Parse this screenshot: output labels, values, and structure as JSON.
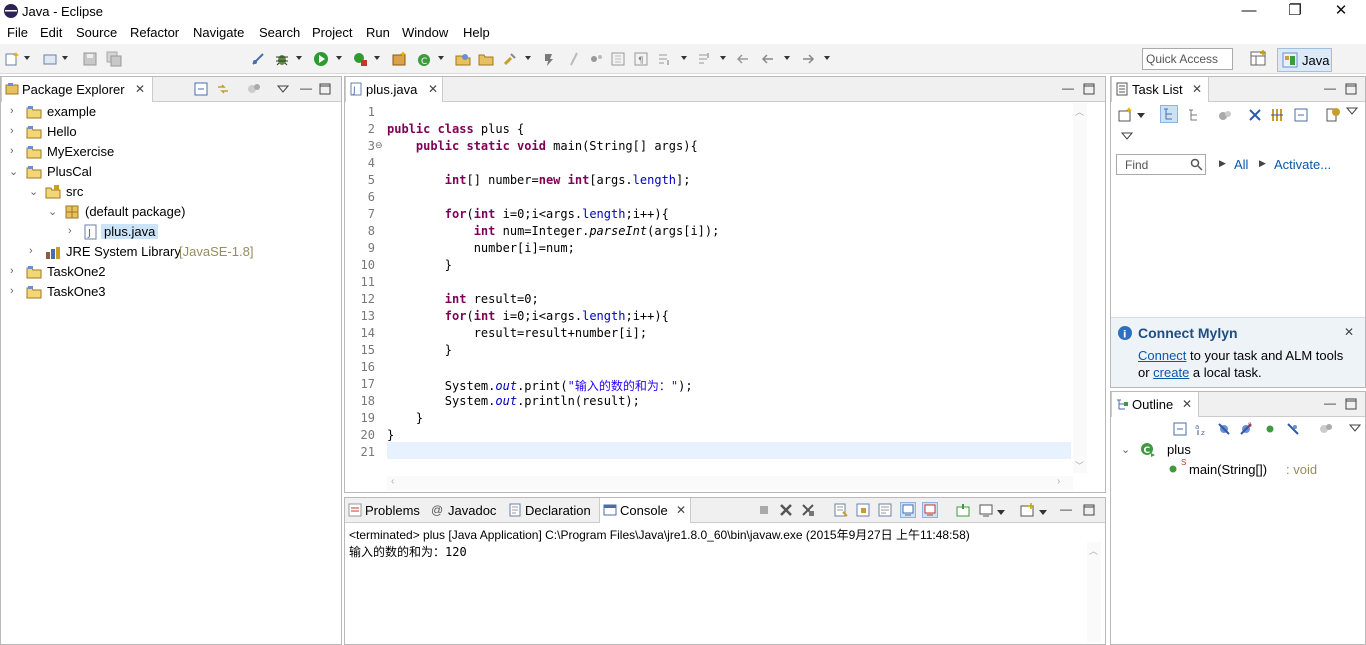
{
  "window": {
    "title": "Java - Eclipse",
    "minimize": "—",
    "maximize": "❐",
    "close": "✕"
  },
  "menu": [
    "File",
    "Edit",
    "Source",
    "Refactor",
    "Navigate",
    "Search",
    "Project",
    "Run",
    "Window",
    "Help"
  ],
  "toolbar": {
    "quick_access_placeholder": "Quick Access",
    "perspective": "Java"
  },
  "package_explorer": {
    "tab": "Package Explorer",
    "items": [
      {
        "label": "example"
      },
      {
        "label": "Hello"
      },
      {
        "label": "MyExercise"
      },
      {
        "label": "PlusCal"
      },
      {
        "label": "src"
      },
      {
        "label": "(default package)"
      },
      {
        "label": "plus.java"
      },
      {
        "label": "JRE System Library",
        "suffix": "[JavaSE-1.8]"
      },
      {
        "label": "TaskOne2"
      },
      {
        "label": "TaskOne3"
      }
    ]
  },
  "editor": {
    "tab": "plus.java",
    "line_numbers": [
      "1",
      "2",
      "3",
      "4",
      "5",
      "6",
      "7",
      "8",
      "9",
      "10",
      "11",
      "12",
      "13",
      "14",
      "15",
      "16",
      "17",
      "18",
      "19",
      "20",
      "21"
    ]
  },
  "task_list": {
    "tab": "Task List",
    "find_placeholder": "Find",
    "all": "All",
    "activate": "Activate...",
    "mylyn_title": "Connect Mylyn",
    "mylyn_connect": "Connect",
    "mylyn_text1": " to your task and ALM tools",
    "mylyn_or": "or ",
    "mylyn_create": "create",
    "mylyn_text2": " a local task."
  },
  "outline": {
    "tab": "Outline",
    "class_name": "plus",
    "method": "main(String[])",
    "method_type": " : void",
    "static_marker": "S"
  },
  "bottom_tabs": {
    "problems": "Problems",
    "javadoc": "Javadoc",
    "declaration": "Declaration",
    "console": "Console"
  },
  "console": {
    "status": "<terminated> plus [Java Application] C:\\Program Files\\Java\\jre1.8.0_60\\bin\\javaw.exe (2015年9月27日 上午11:48:58)",
    "output": "输入的数的和为：120"
  },
  "colors": {
    "keyword": "#7f0055",
    "field": "#0000c0",
    "string": "#2a00ff",
    "link": "#0b57a8"
  }
}
